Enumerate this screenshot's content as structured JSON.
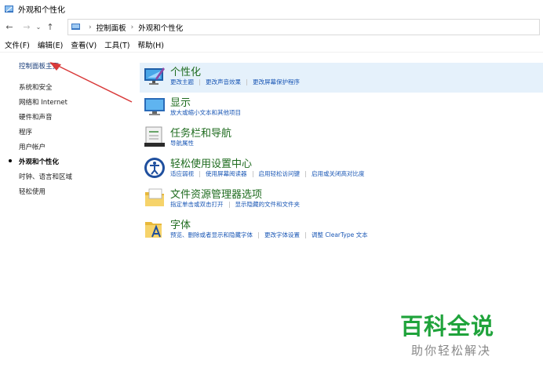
{
  "window": {
    "title": "外观和个性化"
  },
  "address": {
    "crumbs": [
      "控制面板",
      "外观和个性化"
    ]
  },
  "menubar": [
    "文件(F)",
    "编辑(E)",
    "查看(V)",
    "工具(T)",
    "帮助(H)"
  ],
  "sidebar": {
    "home": "控制面板主页",
    "items": [
      "系统和安全",
      "网络和 Internet",
      "硬件和声音",
      "程序",
      "用户帐户",
      "外观和个性化",
      "时钟、语言和区域",
      "轻松使用"
    ],
    "current_index": 5
  },
  "categories": [
    {
      "title": "个性化",
      "icon": "personalization-icon",
      "links": [
        "更改主题",
        "更改声音效果",
        "更改屏幕保护程序"
      ]
    },
    {
      "title": "显示",
      "icon": "display-icon",
      "links": [
        "放大或缩小文本和其他项目"
      ]
    },
    {
      "title": "任务栏和导航",
      "icon": "taskbar-icon",
      "links": [
        "导航属性"
      ]
    },
    {
      "title": "轻松使用设置中心",
      "icon": "ease-of-access-icon",
      "links": [
        "适应弱视",
        "使用屏幕阅读器",
        "启用轻松访问键",
        "启用或关闭高对比度"
      ]
    },
    {
      "title": "文件资源管理器选项",
      "icon": "folder-options-icon",
      "links": [
        "指定单击或双击打开",
        "显示隐藏的文件和文件夹"
      ]
    },
    {
      "title": "字体",
      "icon": "fonts-icon",
      "links": [
        "预览、删除或者显示和隐藏字体",
        "更改字体设置",
        "调整 ClearType 文本"
      ]
    }
  ],
  "watermark": {
    "main": "百科全说",
    "sub": "助你轻松解决"
  },
  "colors": {
    "title_green": "#1e6b1e",
    "link_blue": "#1a57b5",
    "highlight": "#e5f1fb",
    "arrow_red": "#d93a3a",
    "watermark_green": "#1fa33b"
  }
}
